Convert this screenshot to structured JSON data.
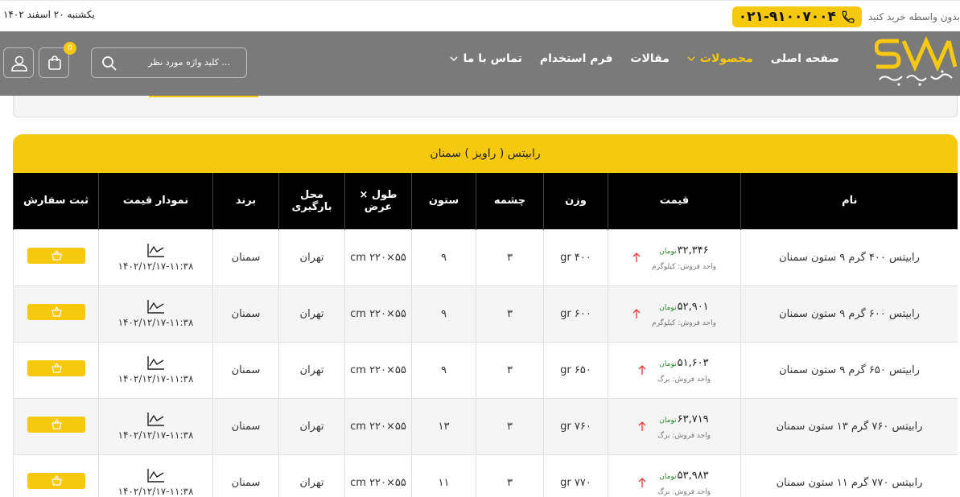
{
  "topbar": {
    "date": "یکشنبه ۲۰ اسفند ۱۴۰۲",
    "contact_text": "بدون واسطه خرید کنید",
    "phone": "۰۲۱-۹۱۰۰۷۰۰۴"
  },
  "nav": {
    "logo_text": "شهر مفتول",
    "menu": [
      {
        "label": "صفحه اصلی"
      },
      {
        "label": "محصولات"
      },
      {
        "label": "مقالات"
      },
      {
        "label": "فرم استخدام"
      },
      {
        "label": "تماس با ما"
      }
    ],
    "search_placeholder": "کلید واژه مورد نظر ...",
    "cart_count": "0"
  },
  "table": {
    "title": "رابیتس ( راویز )  سمنان",
    "headers": {
      "name": "نام",
      "price": "قیمت",
      "weight": "وزن",
      "mesh": "چشمه",
      "column": "ستون",
      "dims": "طول × عرض",
      "loading": "محل بارگیری",
      "brand": "برند",
      "chart": "نمودار قیمت",
      "order": "ثبت سفارش"
    },
    "rows": [
      {
        "name": "رابیتس ۴۰۰ گرم ۹ ستون سمنان",
        "price": "۳۲,۳۴۶",
        "currency": "تومان",
        "unit": "واحد فروش: کیلوگرم",
        "weight": "۴۰۰ gr",
        "mesh": "۳",
        "column": "۹",
        "dims": "۵۵×۲۲۰ cm",
        "loading": "تهران",
        "brand": "سمنان",
        "date": "۱۴۰۲/۱۲/۱۷-۱۱:۳۸"
      },
      {
        "name": "رابیتس ۶۰۰ گرم ۹ ستون سمنان",
        "price": "۵۲,۹۰۱",
        "currency": "تومان",
        "unit": "واحد فروش: کیلوگرم",
        "weight": "۶۰۰ gr",
        "mesh": "۳",
        "column": "۹",
        "dims": "۵۵×۲۲۰ cm",
        "loading": "تهران",
        "brand": "سمنان",
        "date": "۱۴۰۲/۱۲/۱۷-۱۱:۳۸"
      },
      {
        "name": "رابیتس ۶۵۰ گرم ۹ ستون سمنان",
        "price": "۵۱,۶۰۳",
        "currency": "تومان",
        "unit": "واحد فروش: برگ",
        "weight": "۶۵۰ gr",
        "mesh": "۳",
        "column": "۹",
        "dims": "۵۵×۲۲۰ cm",
        "loading": "تهران",
        "brand": "سمنان",
        "date": "۱۴۰۲/۱۲/۱۷-۱۱:۳۸"
      },
      {
        "name": "رابیتس ۷۶۰ گرم ۱۳ ستون سمنان",
        "price": "۶۳,۷۱۹",
        "currency": "تومان",
        "unit": "واحد فروش: برگ",
        "weight": "۷۶۰ gr",
        "mesh": "۳",
        "column": "۱۳",
        "dims": "۵۵×۲۲۰ cm",
        "loading": "تهران",
        "brand": "سمنان",
        "date": "۱۴۰۲/۱۲/۱۷-۱۱:۳۸"
      },
      {
        "name": "رابیتس ۷۷۰ گرم ۱۱ ستون سمنان",
        "price": "۵۳,۹۸۳",
        "currency": "تومان",
        "unit": "واحد فروش: برگ",
        "weight": "۷۷۰ gr",
        "mesh": "۳",
        "column": "۱۱",
        "dims": "۵۵×۲۲۰ cm",
        "loading": "تهران",
        "brand": "سمنان",
        "date": "۱۴۰۲/۱۲/۱۷-۱۱:۳۸"
      }
    ]
  },
  "colors": {
    "accent": "#f6c90e",
    "nav_bg": "#7a7a7a",
    "header_bg": "#000000",
    "price_up": "#e53935",
    "currency": "#2a8a2a"
  }
}
